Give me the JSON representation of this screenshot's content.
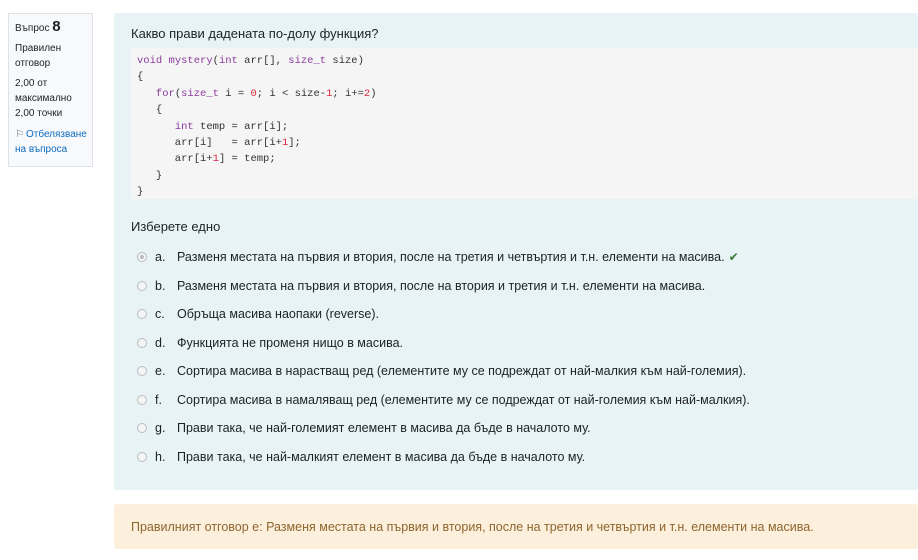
{
  "info": {
    "question_label": "Въпрос",
    "question_number": "8",
    "state_line1": "Правилен",
    "state_line2": "отговор",
    "grade_line1": "2,00 от",
    "grade_line2": "максимално",
    "grade_line3": "2,00 точки",
    "flag_line1": "Отбелязване",
    "flag_line2": "на въпроса"
  },
  "question": {
    "text": "Какво прави дадената по-долу функция?",
    "code_lines": [
      "void mystery(int arr[], size_t size)",
      "{",
      "   for(size_t i = 0; i < size-1; i+=2)",
      "   {",
      "      int temp = arr[i];",
      "      arr[i]   = arr[i+1];",
      "      arr[i+1] = temp;",
      "   }",
      "}"
    ],
    "prompt": "Изберете едно"
  },
  "answers": [
    {
      "letter": "a.",
      "text": "Разменя местата на първия и втория, после на третия и четвъртия и т.н. елементи на масива.",
      "checked": true,
      "correct": true
    },
    {
      "letter": "b.",
      "text": "Разменя местата на първия и втория, после на втория и третия и т.н. елементи на масива.",
      "checked": false
    },
    {
      "letter": "c.",
      "text": "Обръща масива наопаки (reverse).",
      "checked": false
    },
    {
      "letter": "d.",
      "text": "Функцията не променя нищо в масива.",
      "checked": false
    },
    {
      "letter": "e.",
      "text": "Сортира масива в нарастващ ред (елементите му се подреждат от най-малкия към най-големия).",
      "checked": false
    },
    {
      "letter": "f.",
      "text": "Сортира масива в намаляващ ред (елементите му се подреждат от най-големия към най-малкия).",
      "checked": false
    },
    {
      "letter": "g.",
      "text": "Прави така, че най-големият елемент в масива да бъде в началото му.",
      "checked": false
    },
    {
      "letter": "h.",
      "text": "Прави така, че най-малкият елемент в масива да бъде в началото му.",
      "checked": false
    }
  ],
  "feedback": {
    "text": "Правилният отговор е: Разменя местата на първия и втория, после на третия и четвъртия и т.н. елементи на масива."
  },
  "colors": {
    "formulation_bg": "#e7f3f5",
    "feedback_bg": "#fcefdc",
    "feedback_text": "#8e662e",
    "link": "#0f6cbf",
    "correct_check": "#357a32"
  },
  "icons": {
    "flag": "flag-icon",
    "correct": "check-icon"
  }
}
